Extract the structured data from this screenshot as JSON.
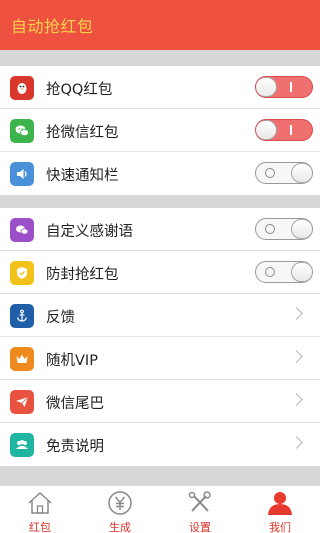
{
  "header": {
    "title": "自动抢红包"
  },
  "section1": [
    {
      "label": "抢QQ红包",
      "icon": "qq-penguin-icon",
      "icon_color": "#d9372b",
      "toggle": "on"
    },
    {
      "label": "抢微信红包",
      "icon": "wechat-icon",
      "icon_color": "#3cb44b",
      "toggle": "on"
    },
    {
      "label": "快速通知栏",
      "icon": "speaker-icon",
      "icon_color": "#4a90d9",
      "toggle": "off"
    }
  ],
  "section2": [
    {
      "label": "自定义感谢语",
      "icon": "chat-bubbles-icon",
      "icon_color": "#9b4fc9",
      "toggle": "off"
    },
    {
      "label": "防封抢红包",
      "icon": "shield-icon",
      "icon_color": "#f2c21b",
      "toggle": "off"
    },
    {
      "label": "反馈",
      "icon": "anchor-icon",
      "icon_color": "#1f5fa8",
      "chevron": true
    },
    {
      "label": "随机VIP",
      "icon": "crown-icon",
      "icon_color": "#ef8a1f",
      "chevron": true
    },
    {
      "label": "微信尾巴",
      "icon": "paper-plane-icon",
      "icon_color": "#e8523f",
      "chevron": true
    },
    {
      "label": "免责说明",
      "icon": "people-icon",
      "icon_color": "#20b5a0",
      "chevron": true
    }
  ],
  "tabs": [
    {
      "label": "红包",
      "icon": "home-icon"
    },
    {
      "label": "生成",
      "icon": "yen-icon"
    },
    {
      "label": "设置",
      "icon": "tools-icon"
    },
    {
      "label": "我们",
      "icon": "person-icon"
    }
  ],
  "colors": {
    "accent": "#ee5140",
    "title_text": "#f5d24b",
    "tab_label": "#d9352b",
    "toggle_on": "#f07070"
  }
}
